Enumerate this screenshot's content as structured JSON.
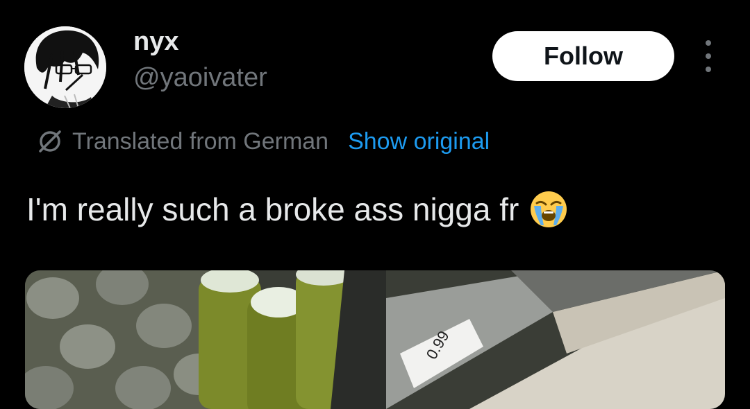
{
  "author": {
    "display_name": "nyx",
    "handle": "@yaoivater",
    "avatar_icon": "anime-avatar"
  },
  "actions": {
    "follow_label": "Follow",
    "more_icon": "more-vertical-icon"
  },
  "translation": {
    "icon": "globe-slash-icon",
    "label": "Translated from German",
    "show_original_label": "Show original"
  },
  "tweet": {
    "text": "I'm really such a broke ass nigga fr",
    "emoji": "loudly-crying-face"
  },
  "media": {
    "price_tag": "0.99"
  },
  "colors": {
    "background": "#000000",
    "text_primary": "#e7e9ea",
    "text_secondary": "#71767b",
    "link": "#1d9bf0",
    "button_bg": "#ffffff"
  }
}
